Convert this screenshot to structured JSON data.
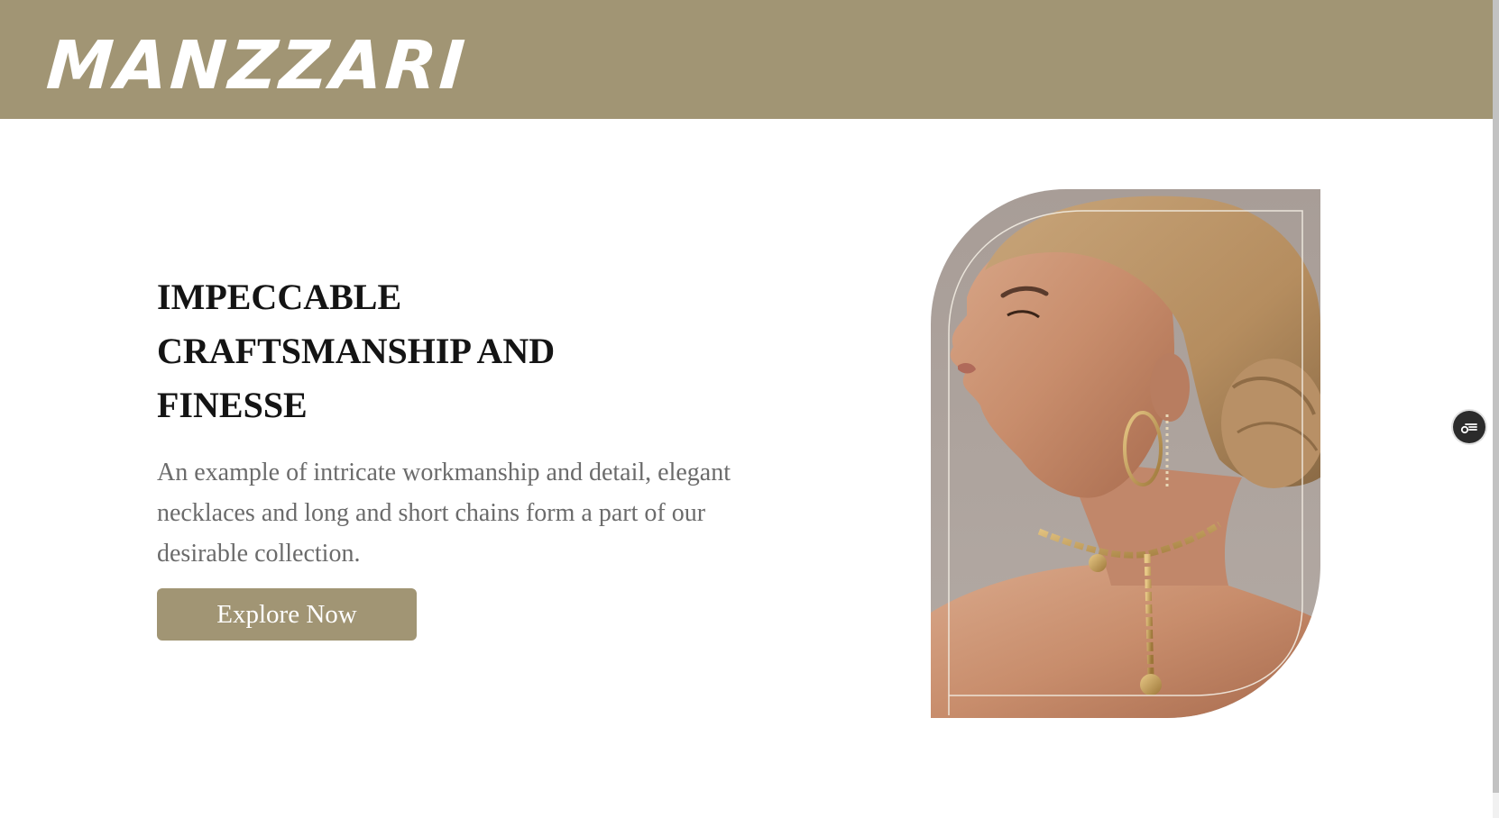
{
  "header": {
    "brand": "MANZZARI",
    "background_color": "#a19574"
  },
  "hero": {
    "headline": "IMPECCABLE CRAFTSMANSHIP AND FINESSE",
    "description": "An example of intricate workmanship and detail, elegant necklaces and long and short chains form a part of our desirable collection.",
    "cta_label": "Explore Now",
    "accent_color": "#a19574"
  },
  "floating_widget": {
    "icon": "filter-settings-icon"
  }
}
